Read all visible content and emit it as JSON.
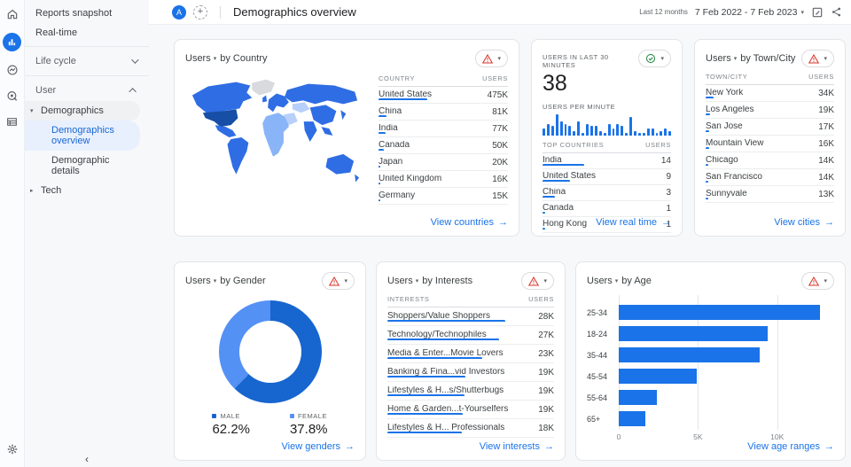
{
  "colors": {
    "accent": "#1a73e8",
    "male": "#1765cf",
    "female": "#5491f5",
    "warning": "#d93025",
    "ok": "#188038",
    "map_mid": "#2f6de4",
    "map_dark": "#174ea6",
    "map_light": "#8ab4f8",
    "map_lighter": "#b8d0f9",
    "map_nodata": "#d8dadd"
  },
  "icon_rail": {
    "items": [
      "home-icon",
      "reports-icon",
      "explore-icon",
      "advertising-icon",
      "library-icon"
    ],
    "settings": "gear-icon"
  },
  "sidebar": {
    "reports_snapshot": "Reports snapshot",
    "real_time": "Real-time",
    "life_cycle": "Life cycle",
    "user": "User",
    "demographics": "Demographics",
    "demographics_overview": "Demographics overview",
    "demographic_details": "Demographic details",
    "tech": "Tech",
    "collapse": "‹"
  },
  "header": {
    "avatar": "A",
    "add": "+",
    "title": "Demographics overview",
    "date_range_label": "Last 12 months",
    "date_range": "7 Feb 2022 - 7 Feb 2023"
  },
  "cards": {
    "country": {
      "title_metric": "Users",
      "title_rest": "by Country",
      "col_dim": "COUNTRY",
      "col_val": "USERS",
      "rows": [
        {
          "name": "United States",
          "value": "475K",
          "bar_pct": 50
        },
        {
          "name": "China",
          "value": "81K",
          "bar_pct": 8
        },
        {
          "name": "India",
          "value": "77K",
          "bar_pct": 7
        },
        {
          "name": "Canada",
          "value": "50K",
          "bar_pct": 5
        },
        {
          "name": "Japan",
          "value": "20K",
          "bar_pct": 2
        },
        {
          "name": "United Kingdom",
          "value": "16K",
          "bar_pct": 2
        },
        {
          "name": "Germany",
          "value": "15K",
          "bar_pct": 2
        }
      ],
      "link": "View countries"
    },
    "realtime": {
      "label": "USERS IN LAST 30 MINUTES",
      "value": "38",
      "sublabel": "USERS PER MINUTE",
      "sparkline": [
        3,
        5,
        4,
        9,
        6,
        5,
        4,
        2,
        6,
        1,
        5,
        4,
        4,
        2,
        1,
        5,
        3,
        5,
        4,
        1,
        8,
        2,
        1,
        1,
        3,
        3,
        1,
        2,
        3,
        2
      ],
      "col_dim": "TOP COUNTRIES",
      "col_val": "USERS",
      "rows": [
        {
          "name": "India",
          "value": "14",
          "bar_pct": 43
        },
        {
          "name": "United States",
          "value": "9",
          "bar_pct": 28
        },
        {
          "name": "China",
          "value": "3",
          "bar_pct": 13
        },
        {
          "name": "Canada",
          "value": "1",
          "bar_pct": 3
        },
        {
          "name": "Hong Kong",
          "value": "1",
          "bar_pct": 3
        }
      ],
      "link": "View real time"
    },
    "city": {
      "title_metric": "Users",
      "title_rest": "by Town/City",
      "col_dim": "TOWN/CITY",
      "col_val": "USERS",
      "rows": [
        {
          "name": "New York",
          "value": "34K",
          "bar_pct": 8
        },
        {
          "name": "Los Angeles",
          "value": "19K",
          "bar_pct": 4.5
        },
        {
          "name": "San Jose",
          "value": "17K",
          "bar_pct": 4
        },
        {
          "name": "Mountain View",
          "value": "16K",
          "bar_pct": 4
        },
        {
          "name": "Chicago",
          "value": "14K",
          "bar_pct": 3
        },
        {
          "name": "San Francisco",
          "value": "14K",
          "bar_pct": 3
        },
        {
          "name": "Sunnyvale",
          "value": "13K",
          "bar_pct": 3
        }
      ],
      "link": "View cities"
    },
    "gender": {
      "title_metric": "Users",
      "title_rest": "by Gender",
      "chart_data": {
        "type": "pie",
        "slices": [
          {
            "label": "MALE",
            "pct": 62.2
          },
          {
            "label": "FEMALE",
            "pct": 37.8
          }
        ]
      },
      "legend": [
        {
          "label": "MALE",
          "value": "62.2%"
        },
        {
          "label": "FEMALE",
          "value": "37.8%"
        }
      ],
      "link": "View genders"
    },
    "interests": {
      "title_metric": "Users",
      "title_rest": "by Interests",
      "col_dim": "INTERESTS",
      "col_val": "USERS",
      "rows": [
        {
          "name": "Shoppers/Value Shoppers",
          "value": "28K",
          "bar_pct": 84
        },
        {
          "name": "Technology/Technophiles",
          "value": "27K",
          "bar_pct": 80
        },
        {
          "name": "Media & Enter...Movie Lovers",
          "value": "23K",
          "bar_pct": 68
        },
        {
          "name": "Banking & Fina...vid Investors",
          "value": "19K",
          "bar_pct": 56
        },
        {
          "name": "Lifestyles & H...s/Shutterbugs",
          "value": "19K",
          "bar_pct": 55
        },
        {
          "name": "Home & Garden...t-Yourselfers",
          "value": "19K",
          "bar_pct": 54
        },
        {
          "name": "Lifestyles & H... Professionals",
          "value": "18K",
          "bar_pct": 53
        }
      ],
      "link": "View interests"
    },
    "age": {
      "title_metric": "Users",
      "title_rest": "by Age",
      "chart_data": {
        "type": "bar",
        "orientation": "horizontal",
        "categories": [
          "25-34",
          "18-24",
          "35-44",
          "45-54",
          "55-64",
          "65+"
        ],
        "values": [
          12700,
          9400,
          8900,
          4900,
          2400,
          1700
        ],
        "xlim": [
          0,
          13600
        ],
        "ticks": [
          {
            "value": 0,
            "label": "0"
          },
          {
            "value": 5000,
            "label": "5K"
          },
          {
            "value": 10000,
            "label": "10K"
          }
        ]
      },
      "link": "View age ranges"
    }
  }
}
